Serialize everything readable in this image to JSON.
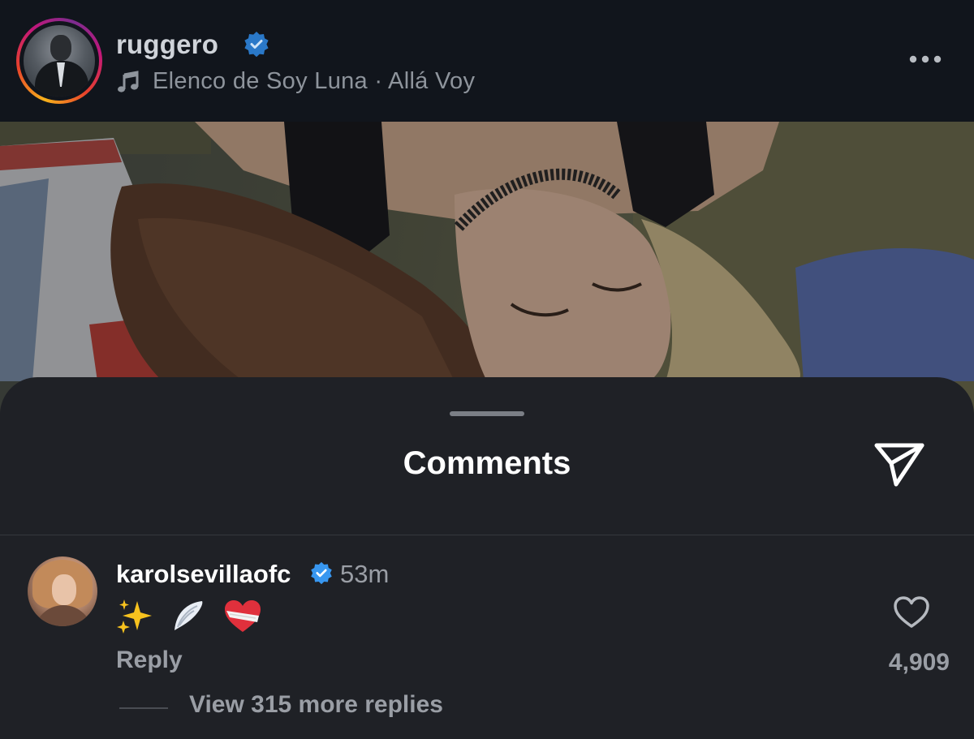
{
  "post": {
    "username": "ruggero",
    "verified": true,
    "song": "Elenco de Soy Luna · Allá Voy",
    "icons": {
      "music": "music-note-icon",
      "more": "more-options-icon",
      "verified": "verified-badge-icon"
    }
  },
  "comments_sheet": {
    "title": "Comments",
    "share_icon": "send-icon",
    "comments": [
      {
        "username": "karolsevillaofc",
        "verified": true,
        "time": "53m",
        "text": "✨ 🪽 ❤️‍🩹",
        "reply_label": "Reply",
        "likes": "4,909",
        "view_replies": "View 315 more replies"
      }
    ]
  },
  "colors": {
    "verified_blue": "#3897f0",
    "sheet_bg": "#1f2126",
    "header_bg": "#11151c",
    "muted_text": "#9a9ea5"
  }
}
